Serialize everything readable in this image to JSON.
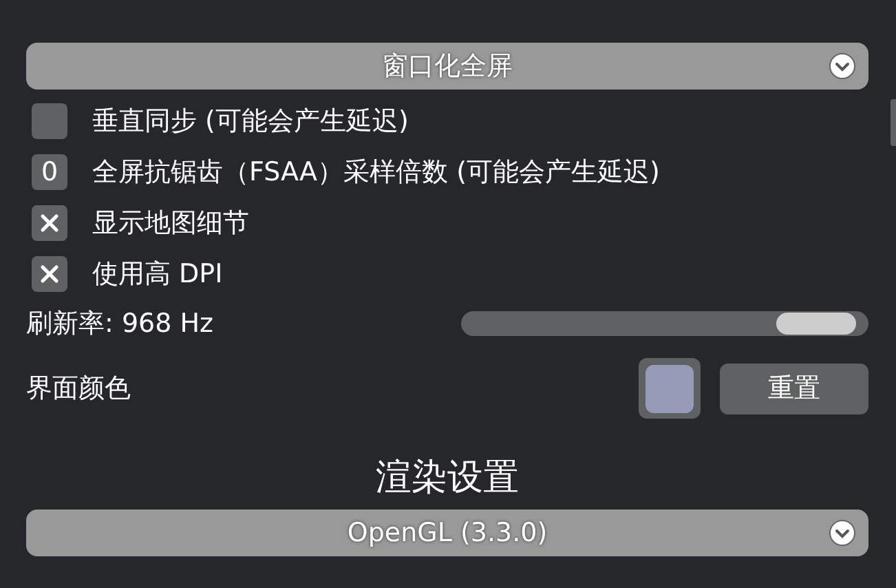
{
  "display_mode": {
    "value": "窗口化全屏"
  },
  "options": [
    {
      "kind": "checkbox",
      "label": "垂直同步 (可能会产生延迟)",
      "checked": false
    },
    {
      "kind": "number",
      "value": "0",
      "label": "全屏抗锯齿（FSAA）采样倍数 (可能会产生延迟)"
    },
    {
      "kind": "checkbox",
      "label": "显示地图细节",
      "checked": true
    },
    {
      "kind": "checkbox",
      "label": "使用高 DPI",
      "checked": true
    }
  ],
  "refresh_rate": {
    "label": "刷新率: 968 Hz",
    "level": 0.97
  },
  "ui_color": {
    "label": "界面颜色",
    "color": "#969cb8",
    "reset": "重置"
  },
  "render_section": {
    "title": "渲染设置",
    "renderer": "OpenGL (3.3.0)"
  }
}
